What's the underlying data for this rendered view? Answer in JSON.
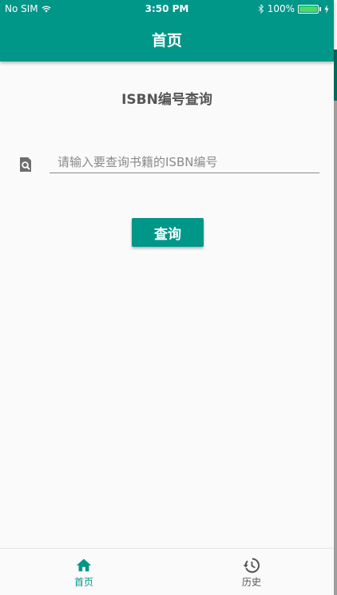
{
  "status_bar": {
    "carrier": "No SIM",
    "time": "3:50 PM",
    "battery": "100%",
    "battery_level": 1.0,
    "icons": [
      "wifi-icon",
      "bluetooth-icon",
      "battery-icon",
      "charging-icon"
    ]
  },
  "app_bar": {
    "title": "首页"
  },
  "main": {
    "heading": "ISBN编号查询",
    "search": {
      "icon": "search-icon",
      "placeholder": "请输入要查询书籍的ISBN编号",
      "value": ""
    },
    "query_button": "查询"
  },
  "bottom_nav": {
    "items": [
      {
        "label": "首页",
        "icon": "home-icon",
        "active": true
      },
      {
        "label": "历史",
        "icon": "history-icon",
        "active": false
      }
    ]
  },
  "colors": {
    "primary": "#009688",
    "primary_dark": "#00695c",
    "text_heading": "#555555",
    "background": "#fafafa",
    "battery_fill": "#4cd964"
  }
}
